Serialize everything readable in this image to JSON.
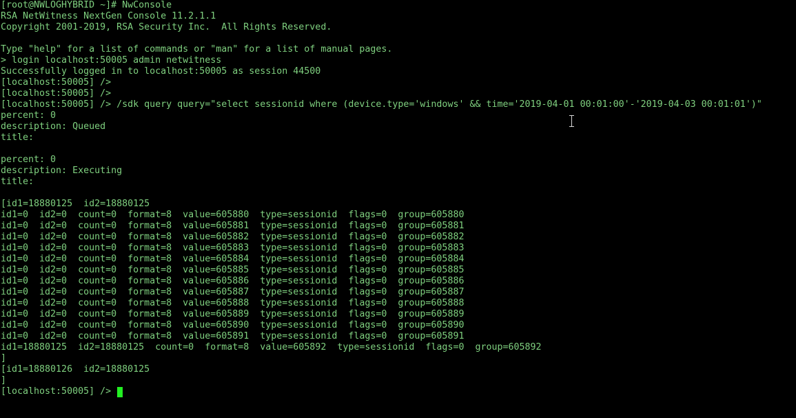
{
  "terminal": {
    "lines": [
      "[root@NWLOGHYBRID ~]# NwConsole",
      "RSA NetWitness NextGen Console 11.2.1.1",
      "Copyright 2001-2019, RSA Security Inc.  All Rights Reserved.",
      "",
      "Type \"help\" for a list of commands or \"man\" for a list of manual pages.",
      "> login localhost:50005 admin netwitness",
      "Successfully logged in to localhost:50005 as session 44500",
      "[localhost:50005] />",
      "[localhost:50005] />",
      "[localhost:50005] /> /sdk query query=\"select sessionid where (device.type='windows' && time='2019-04-01 00:01:00'-'2019-04-03 00:01:01')\"",
      "percent: 0",
      "description: Queued",
      "title:",
      "",
      "percent: 0",
      "description: Executing",
      "title:",
      "",
      "[id1=18880125  id2=18880125",
      "id1=0  id2=0  count=0  format=8  value=605880  type=sessionid  flags=0  group=605880",
      "id1=0  id2=0  count=0  format=8  value=605881  type=sessionid  flags=0  group=605881",
      "id1=0  id2=0  count=0  format=8  value=605882  type=sessionid  flags=0  group=605882",
      "id1=0  id2=0  count=0  format=8  value=605883  type=sessionid  flags=0  group=605883",
      "id1=0  id2=0  count=0  format=8  value=605884  type=sessionid  flags=0  group=605884",
      "id1=0  id2=0  count=0  format=8  value=605885  type=sessionid  flags=0  group=605885",
      "id1=0  id2=0  count=0  format=8  value=605886  type=sessionid  flags=0  group=605886",
      "id1=0  id2=0  count=0  format=8  value=605887  type=sessionid  flags=0  group=605887",
      "id1=0  id2=0  count=0  format=8  value=605888  type=sessionid  flags=0  group=605888",
      "id1=0  id2=0  count=0  format=8  value=605889  type=sessionid  flags=0  group=605889",
      "id1=0  id2=0  count=0  format=8  value=605890  type=sessionid  flags=0  group=605890",
      "id1=0  id2=0  count=0  format=8  value=605891  type=sessionid  flags=0  group=605891",
      "id1=18880125  id2=18880125  count=0  format=8  value=605892  type=sessionid  flags=0  group=605892",
      "]",
      "[id1=18880126  id2=18880125",
      "]"
    ],
    "current_prompt": "[localhost:50005] /> ",
    "colors": {
      "background": "#000000",
      "text": "#7fd07f",
      "cursor": "#22ee22"
    }
  }
}
